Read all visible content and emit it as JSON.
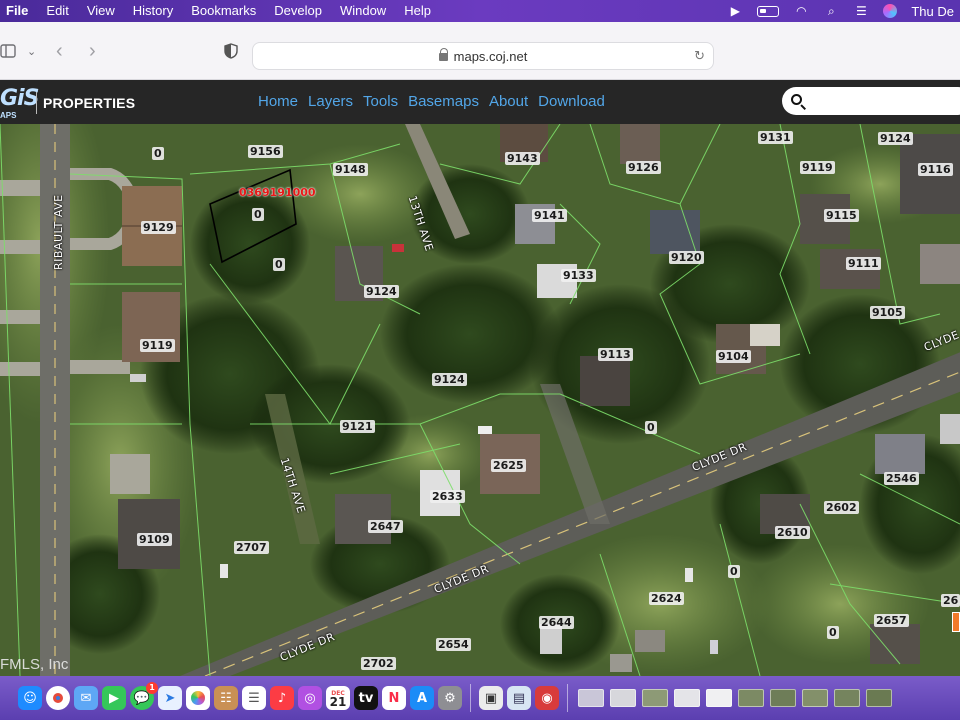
{
  "menubar": {
    "items": [
      "File",
      "Edit",
      "View",
      "History",
      "Bookmarks",
      "Develop",
      "Window",
      "Help"
    ],
    "clock": "Thu De"
  },
  "browser": {
    "url": "maps.coj.net"
  },
  "site": {
    "logo_gis": "GiS",
    "logo_sub": "APS",
    "section": "PROPERTIES",
    "nav": [
      "Home",
      "Layers",
      "Tools",
      "Basemaps",
      "About",
      "Download"
    ]
  },
  "map": {
    "selected_parcel_id": "0369191000",
    "watermark": "FMLS, Inc",
    "streets": {
      "ribault": "RIBAULT AVE",
      "thirteenth": "13TH AVE",
      "fourteenth": "14TH AVE",
      "clyde": "CLYDE DR"
    },
    "parcels": [
      "0",
      "9156",
      "9148",
      "9143",
      "9126",
      "9131",
      "9124",
      "9119",
      "9116",
      "9129",
      "0",
      "0",
      "9141",
      "9120",
      "9115",
      "9111",
      "9124",
      "9133",
      "9105",
      "9119",
      "9113",
      "9104",
      "9124",
      "9121",
      "0",
      "2625",
      "2633",
      "2647",
      "2546",
      "2602",
      "2610",
      "9109",
      "2707",
      "0",
      "2624",
      "2644",
      "2657",
      "0",
      "2654",
      "2702",
      "26"
    ]
  },
  "dock": {
    "messages_badge": "1",
    "calendar_month": "DEC",
    "calendar_day": "21"
  }
}
